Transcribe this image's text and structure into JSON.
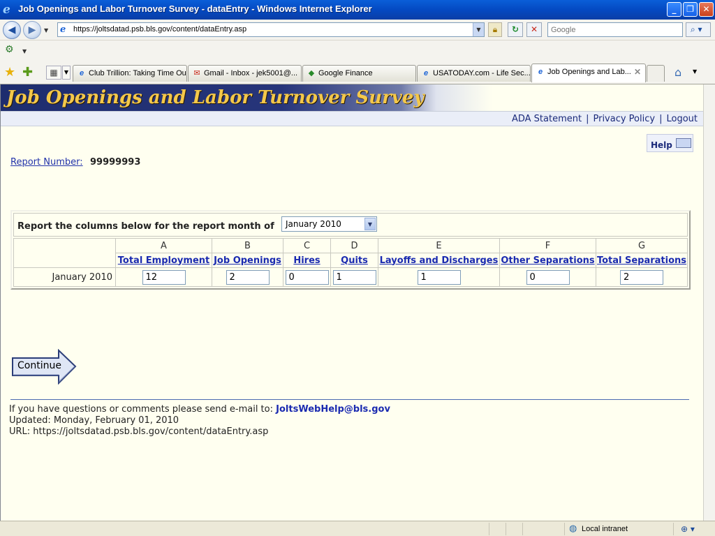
{
  "window": {
    "title": "Job Openings and Labor Turnover Survey - dataEntry - Windows Internet Explorer"
  },
  "browser": {
    "url": "https://joltsdatad.psb.bls.gov/content/dataEntry.asp",
    "search_placeholder": "Google",
    "tabs": [
      {
        "label": "Club Trillion: Taking Time Out"
      },
      {
        "label": "Gmail - Inbox - jek5001@..."
      },
      {
        "label": "Google Finance"
      },
      {
        "label": "USATODAY.com - Life Sec..."
      },
      {
        "label": "Job Openings and Lab...",
        "active": true
      }
    ]
  },
  "page": {
    "banner_title": "Job Openings and Labor Turnover Survey",
    "nav_links": [
      "ADA Statement",
      "Privacy Policy",
      "Logout"
    ],
    "help_label": "Help",
    "report_number_label": "Report Number:",
    "report_number_value": "99999993",
    "month_prompt": "Report the columns below for the report month of",
    "month_selected": "January 2010",
    "columns": [
      {
        "letter": "A",
        "label": "Total Employment",
        "value": "12"
      },
      {
        "letter": "B",
        "label": "Job Openings",
        "value": "2"
      },
      {
        "letter": "C",
        "label": "Hires",
        "value": "0"
      },
      {
        "letter": "D",
        "label": "Quits",
        "value": "1"
      },
      {
        "letter": "E",
        "label": "Layoffs and Discharges",
        "value": "1"
      },
      {
        "letter": "F",
        "label": "Other Separations",
        "value": "0"
      },
      {
        "letter": "G",
        "label": "Total Separations",
        "value": "2"
      }
    ],
    "row_label": "January 2010",
    "continue_label": "Continue",
    "footer": {
      "question_text": "If you have questions or comments please send e-mail to:",
      "email": "JoltsWebHelp@bls.gov",
      "updated": "Updated: Monday, February 01, 2010",
      "url_line": "URL: https://joltsdatad.psb.bls.gov/content/dataEntry.asp"
    }
  },
  "status": {
    "zone": "Local intranet"
  },
  "colors": {
    "link": "#1a2ab0",
    "banner_text": "#f4c84a",
    "page_bg": "#fffff0"
  }
}
